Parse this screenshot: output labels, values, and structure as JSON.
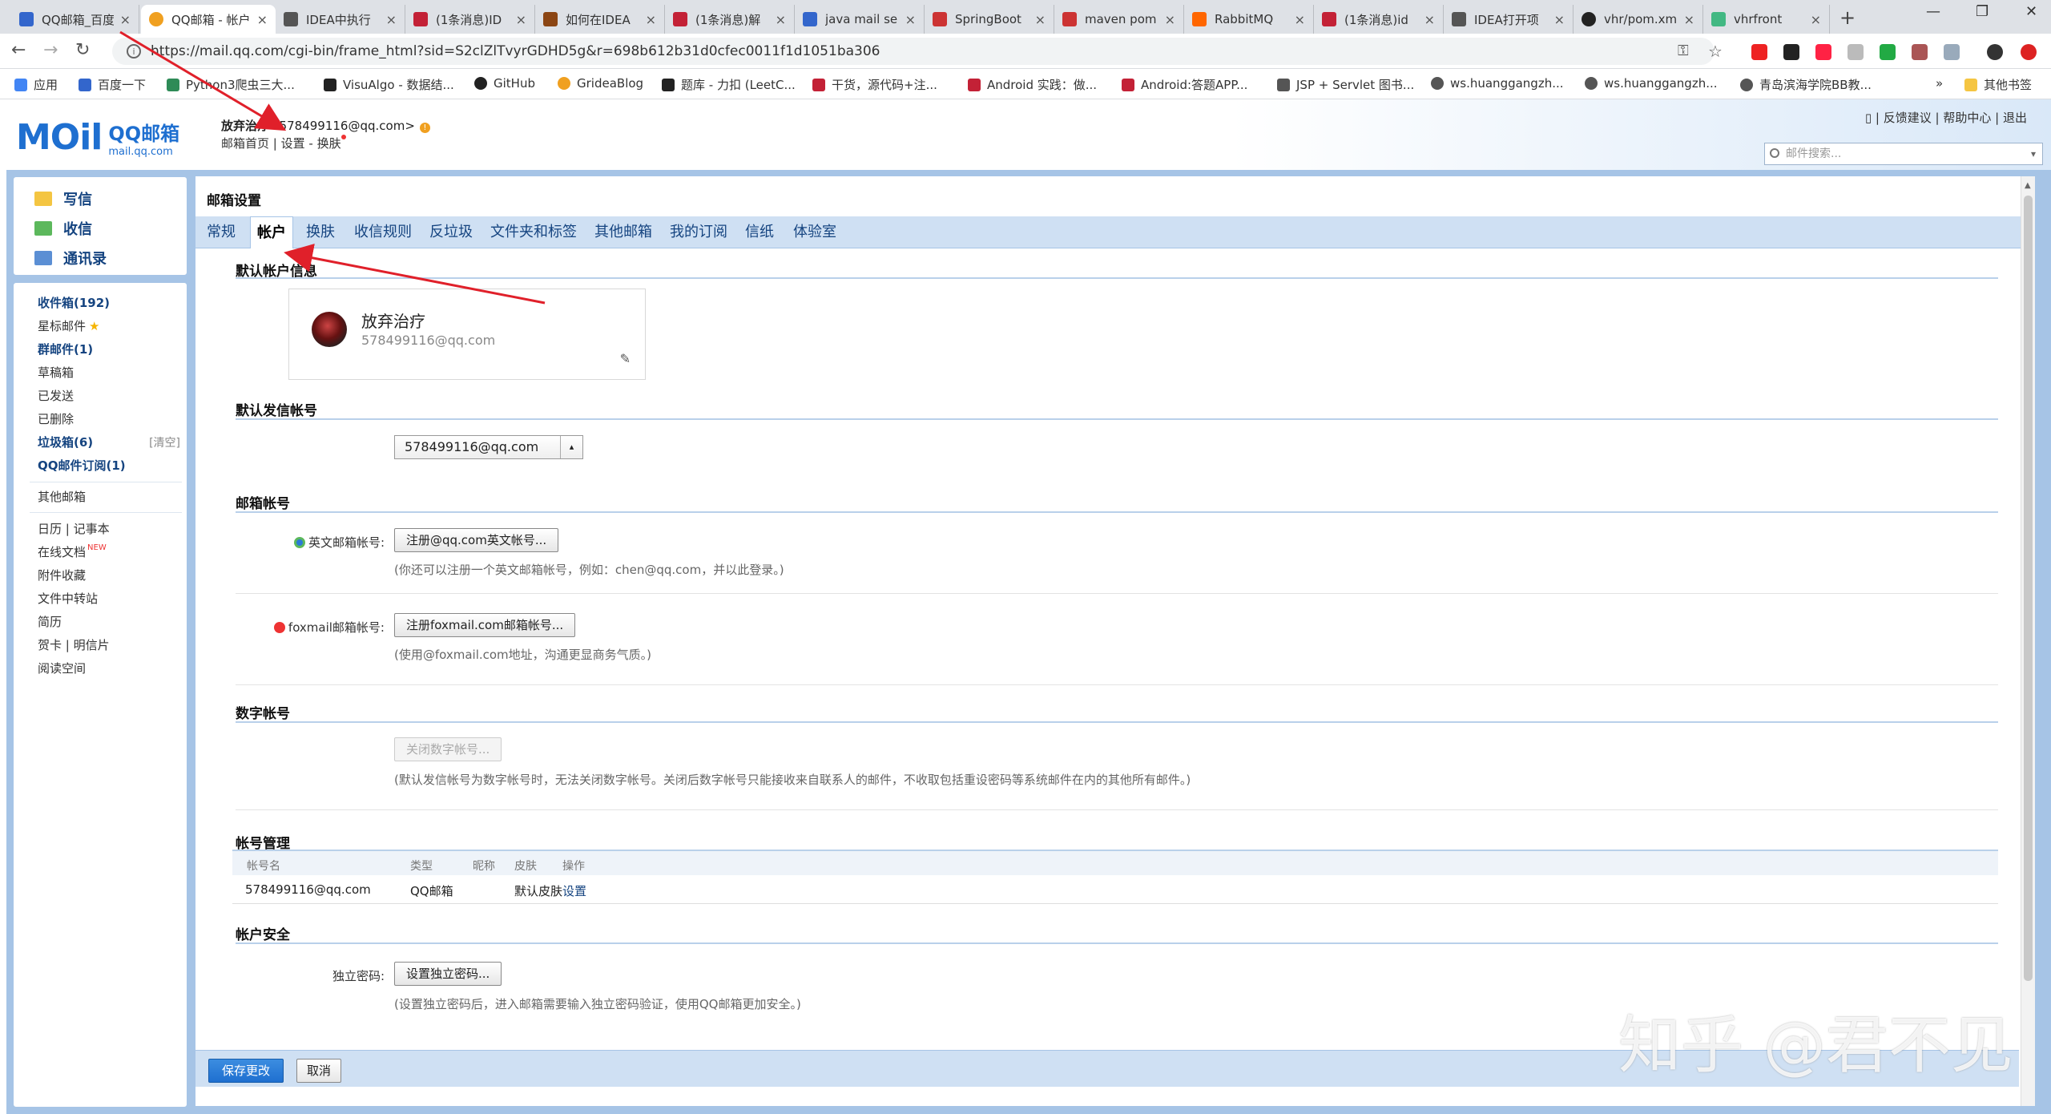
{
  "browser": {
    "tabs": [
      {
        "title": "QQ邮箱_百度",
        "color": "#3366cc"
      },
      {
        "title": "QQ邮箱 - 帐户",
        "color": "#f0a020"
      },
      {
        "title": "IDEA中执行",
        "color": "#555555"
      },
      {
        "title": "(1条消息)ID",
        "color": "#c32136"
      },
      {
        "title": "如何在IDEA",
        "color": "#8b4513"
      },
      {
        "title": "(1条消息)解",
        "color": "#c32136"
      },
      {
        "title": "java mail se",
        "color": "#3366cc"
      },
      {
        "title": "SpringBoot",
        "color": "#cc3333"
      },
      {
        "title": "maven pom",
        "color": "#cc3333"
      },
      {
        "title": "RabbitMQ",
        "color": "#ff6600"
      },
      {
        "title": "(1条消息)id",
        "color": "#c32136"
      },
      {
        "title": "IDEA打开项",
        "color": "#555555"
      },
      {
        "title": "vhr/pom.xm",
        "color": "#222222"
      },
      {
        "title": "vhrfront",
        "color": "#42b883"
      }
    ],
    "url": "https://mail.qq.com/cgi-bin/frame_html?sid=S2clZlTvyrGDHD5g&r=698b612b31d0cfec0011f1d1051ba306",
    "bookmarks": [
      {
        "label": "应用",
        "color": "#4285f4"
      },
      {
        "label": "百度一下",
        "color": "#3366cc"
      },
      {
        "label": "Python3爬虫三大...",
        "color": "#2e8b57"
      },
      {
        "label": "VisuAlgo - 数据结...",
        "color": "#222222"
      },
      {
        "label": "GitHub",
        "color": "#222222"
      },
      {
        "label": "GrideaBlog",
        "color": "#f0a020"
      },
      {
        "label": "题库 - 力扣 (LeetC...",
        "color": "#222222"
      },
      {
        "label": "干货，源代码+注...",
        "color": "#c32136"
      },
      {
        "label": "Android 实践：做...",
        "color": "#c32136"
      },
      {
        "label": "Android:答题APP...",
        "color": "#c32136"
      },
      {
        "label": "JSP + Servlet 图书...",
        "color": "#555555"
      },
      {
        "label": "ws.huanggangzh...",
        "color": "#555555"
      },
      {
        "label": "ws.huanggangzh...",
        "color": "#555555"
      },
      {
        "label": "青岛滨海学院BB教...",
        "color": "#555555"
      }
    ],
    "more_bookmarks": "»",
    "other_bookmarks": "其他书签"
  },
  "mail_header": {
    "logo_main": "MOil",
    "logo_cn": "QQ邮箱",
    "logo_domain": "mail.qq.com",
    "user_name": "放弃治疗",
    "user_email": "<578499116@qq.com>",
    "home_link": "邮箱首页",
    "settings_link": "设置",
    "skin_link": "换肤",
    "top_links": {
      "feedback": "反馈建议",
      "help": "帮助中心",
      "logout": "退出"
    },
    "search_placeholder": "邮件搜索..."
  },
  "sidebar": {
    "compose": "写信",
    "inbox": "收信",
    "contacts": "通讯录",
    "folders": {
      "inbox": "收件箱(192)",
      "starred": "星标邮件",
      "group": "群邮件(1)",
      "drafts": "草稿箱",
      "sent": "已发送",
      "deleted": "已删除",
      "spam": "垃圾箱(6)",
      "spam_clear": "[清空]",
      "subscriptions": "QQ邮件订阅(1)",
      "other_mailboxes": "其他邮箱",
      "calendar": "日历",
      "notebook": "记事本",
      "online_docs": "在线文档",
      "new_tag": "NEW",
      "attachments": "附件收藏",
      "file_transfer": "文件中转站",
      "resume": "简历",
      "cards": "贺卡",
      "postcards": "明信片",
      "reading": "阅读空间"
    }
  },
  "settings": {
    "title": "邮箱设置",
    "tabs": [
      "常规",
      "帐户",
      "换肤",
      "收信规则",
      "反垃圾",
      "文件夹和标签",
      "其他邮箱",
      "我的订阅",
      "信纸",
      "体验室"
    ],
    "active_tab": "帐户",
    "default_account_info": {
      "heading": "默认帐户信息",
      "name": "放弃治疗",
      "email": "578499116@qq.com"
    },
    "default_sender": {
      "heading": "默认发信帐号",
      "selected": "578499116@qq.com"
    },
    "mail_accounts": {
      "heading": "邮箱帐号",
      "english_label": "英文邮箱帐号:",
      "english_button": "注册@qq.com英文帐号...",
      "english_hint": "(你还可以注册一个英文邮箱帐号，例如：chen@qq.com，并以此登录。)",
      "foxmail_label": "foxmail邮箱帐号:",
      "foxmail_button": "注册foxmail.com邮箱帐号...",
      "foxmail_hint": "(使用@foxmail.com地址，沟通更显商务气质。)"
    },
    "digital_account": {
      "heading": "数字帐号",
      "button": "关闭数字帐号...",
      "hint": "(默认发信帐号为数字帐号时，无法关闭数字帐号。关闭后数字帐号只能接收来自联系人的邮件，不收取包括重设密码等系统邮件在内的其他所有邮件。)"
    },
    "account_management": {
      "heading": "帐号管理",
      "columns": [
        "帐号名",
        "类型",
        "昵称",
        "皮肤",
        "操作"
      ],
      "rows": [
        {
          "account": "578499116@qq.com",
          "type": "QQ邮箱",
          "nickname": "",
          "skin": "默认皮肤",
          "action": "设置"
        }
      ]
    },
    "security": {
      "heading": "帐户安全",
      "label": "独立密码:",
      "button": "设置独立密码...",
      "hint": "(设置独立密码后，进入邮箱需要输入独立密码验证，使用QQ邮箱更加安全。)"
    },
    "save": "保存更改",
    "cancel": "取消"
  },
  "watermark": "知乎 @君不见",
  "colors": {
    "brand": "#1e6fd0",
    "frame": "#a6c4e6",
    "annotation_arrow": "#e0202a"
  }
}
